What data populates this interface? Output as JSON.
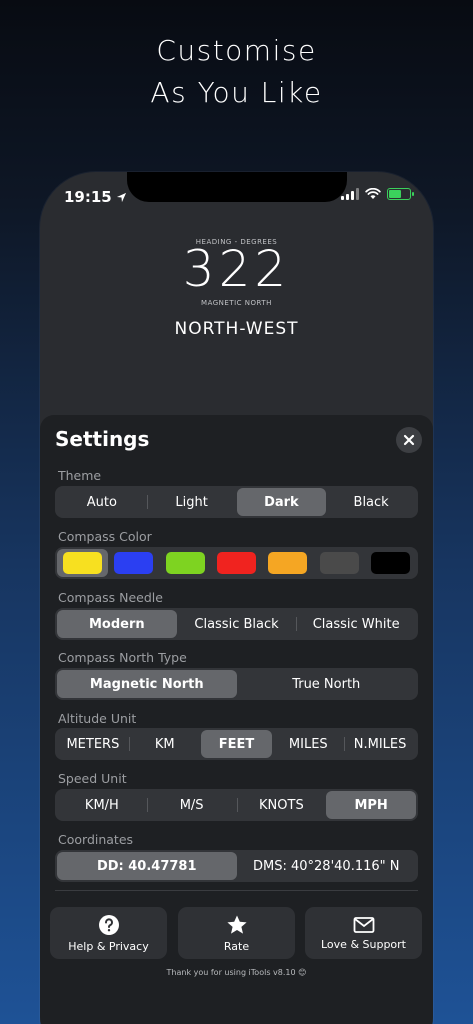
{
  "headline": {
    "line1": "Customise",
    "line2": "As You Like"
  },
  "status_bar": {
    "time": "19:15"
  },
  "heading": {
    "caption_top": "HEADING - DEGREES",
    "value": "322",
    "caption_bottom": "MAGNETIC NORTH",
    "direction": "NORTH-WEST"
  },
  "settings": {
    "title": "Settings",
    "theme": {
      "label": "Theme",
      "options": [
        "Auto",
        "Light",
        "Dark",
        "Black"
      ],
      "selected": "Dark"
    },
    "compass_color": {
      "label": "Compass Color",
      "colors": [
        "#f7e020",
        "#2b3ff2",
        "#7ed321",
        "#f0231f",
        "#f5a623",
        "#4a4a4a",
        "#000000"
      ],
      "selected": "#f7e020"
    },
    "compass_needle": {
      "label": "Compass Needle",
      "options": [
        "Modern",
        "Classic Black",
        "Classic White"
      ],
      "selected": "Modern"
    },
    "north_type": {
      "label": "Compass North Type",
      "options": [
        "Magnetic North",
        "True North"
      ],
      "selected": "Magnetic North"
    },
    "altitude_unit": {
      "label": "Altitude Unit",
      "options": [
        "METERS",
        "KM",
        "FEET",
        "MILES",
        "N.MILES"
      ],
      "selected": "FEET"
    },
    "speed_unit": {
      "label": "Speed Unit",
      "options": [
        "KM/H",
        "M/S",
        "KNOTS",
        "MPH"
      ],
      "selected": "MPH"
    },
    "coordinates": {
      "label": "Coordinates",
      "options": [
        "DD: 40.47781",
        "DMS: 40°28'40.116\" N"
      ],
      "selected": "DD: 40.47781"
    }
  },
  "actions": {
    "help": "Help & Privacy",
    "rate": "Rate",
    "support": "Love & Support"
  },
  "footer": "Thank you for using iTools v8.10 😊"
}
